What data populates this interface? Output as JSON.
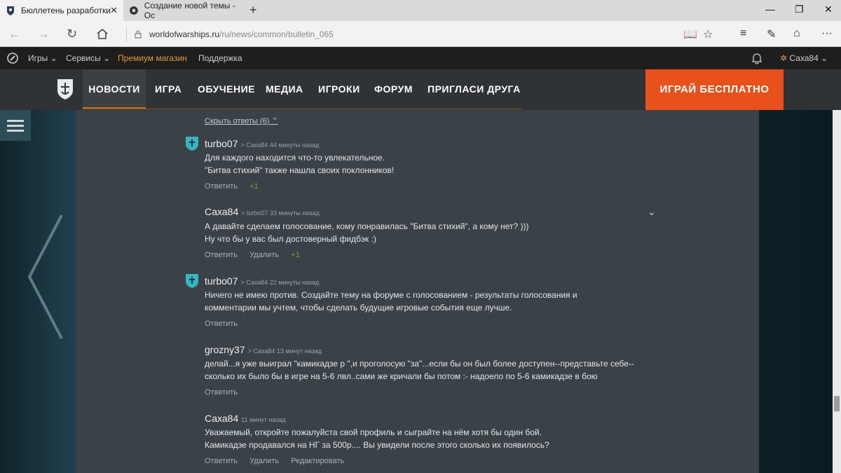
{
  "browser": {
    "tabs": [
      {
        "label": "Бюллетень разработки"
      },
      {
        "label": "Создание новой темы - Ос"
      }
    ],
    "url_domain": "worldofwarships.ru",
    "url_path": "/ru/news/common/bulletin_065"
  },
  "wgbar": {
    "games": "Игры",
    "services": "Сервисы",
    "premium": "Премиум магазин",
    "support": "Поддержка",
    "user": "Саха84"
  },
  "nav": {
    "items": [
      "НОВОСТИ",
      "ИГРА",
      "ОБУЧЕНИЕ",
      "МЕДИА",
      "ИГРОКИ",
      "ФОРУМ",
      "ПРИГЛАСИ ДРУГА"
    ],
    "play": "ИГРАЙ БЕСПЛАТНО"
  },
  "thread": {
    "hide_replies": "Скрыть ответы (6)",
    "comments": [
      {
        "author": "turbo07",
        "meta": "> Саха84  44 минуты назад",
        "lines": [
          "Для каждого находится что-то увлекательное.",
          "\"Битва стихий\" также нашла своих поклонников!"
        ],
        "reply": "Ответить",
        "rating": "+1"
      },
      {
        "author": "Саха84",
        "meta": "> turbo07  33 минуты назад",
        "lines": [
          "А давайте сделаем голосование, кому понравилась \"Битва стихий\", а кому нет? )))",
          "Ну что бы у вас был достоверный фидбэк :)"
        ],
        "reply": "Ответить",
        "delete": "Удалить",
        "rating": "+1"
      },
      {
        "author": "turbo07",
        "meta": "> Саха84  22 минуты назад",
        "lines": [
          "Ничего не имею против. Создайте тему на форуме с голосованием - результаты голосования и",
          "комментарии мы учтем, чтобы сделать будущие игровые события еще лучше."
        ],
        "reply": "Ответить"
      },
      {
        "author": "grozny37",
        "meta": "> Саха84  13 минут назад",
        "lines": [
          "делай...я уже выиграл \"камикадзе р \",и проголосую \"за\"...если бы он был более доступен--представьте себе--",
          "сколько их было бы в игре на 5-6 лвл..сами же кричали бы потом :- надоело по 5-6 камикадзе в бою"
        ],
        "reply": "Ответить"
      },
      {
        "author": "Саха84",
        "meta": "11 минут назад",
        "lines": [
          "Уважаемый, откройте пожалуйста свой профиль и сыграйте на нём хотя бы один бой.",
          "Камикадзе продавался на НГ за 500р.... Вы увидели после этого сколько их появилось?"
        ],
        "reply": "Ответить",
        "delete": "Удалить",
        "edit": "Редактировать"
      }
    ]
  }
}
